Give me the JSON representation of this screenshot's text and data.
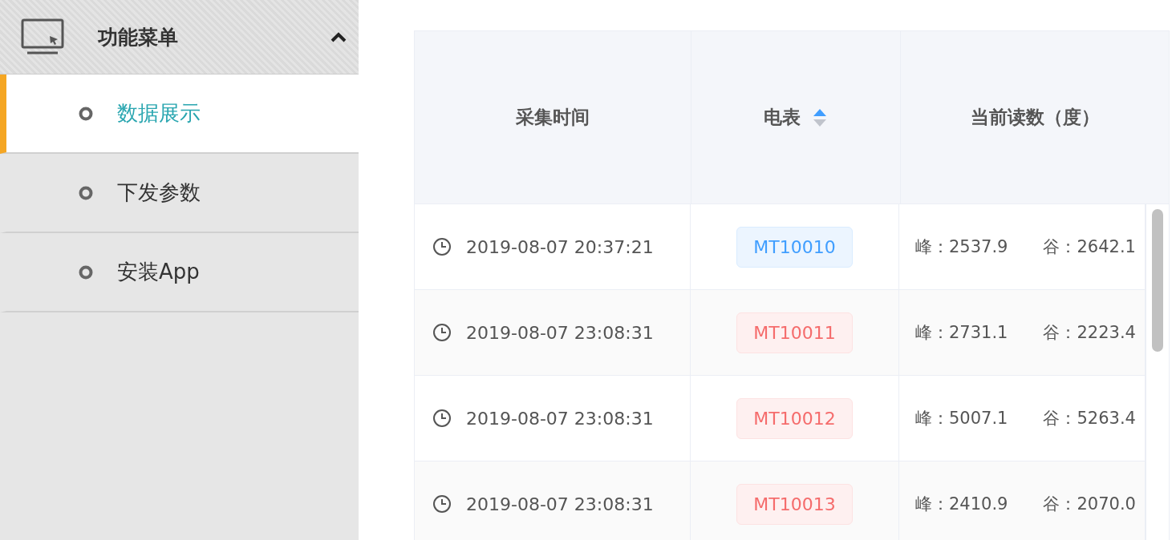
{
  "sidebar": {
    "title": "功能菜单",
    "expanded": true,
    "items": [
      {
        "label": "数据展示",
        "selected": true
      },
      {
        "label": "下发参数",
        "selected": false
      },
      {
        "label": "安装App",
        "selected": false
      }
    ]
  },
  "table": {
    "columns": [
      {
        "label": "采集时间",
        "sortable": false
      },
      {
        "label": "电表",
        "sortable": true,
        "ascending": true
      },
      {
        "label": "当前读数（度）",
        "sortable": false
      }
    ],
    "rows": [
      {
        "time": "2019-08-07 20:37:21",
        "meter": "MT10010",
        "kind": "primary",
        "peak": "峰：2537.9",
        "valley": "谷：2642.1"
      },
      {
        "time": "2019-08-07 23:08:31",
        "meter": "MT10011",
        "kind": "danger",
        "peak": "峰：2731.1",
        "valley": "谷：2223.4"
      },
      {
        "time": "2019-08-07 23:08:31",
        "meter": "MT10012",
        "kind": "danger",
        "peak": "峰：5007.1",
        "valley": "谷：5263.4"
      },
      {
        "time": "2019-08-07 23:08:31",
        "meter": "MT10013",
        "kind": "danger",
        "peak": "峰：2410.9",
        "valley": "谷：2070.0"
      }
    ]
  }
}
